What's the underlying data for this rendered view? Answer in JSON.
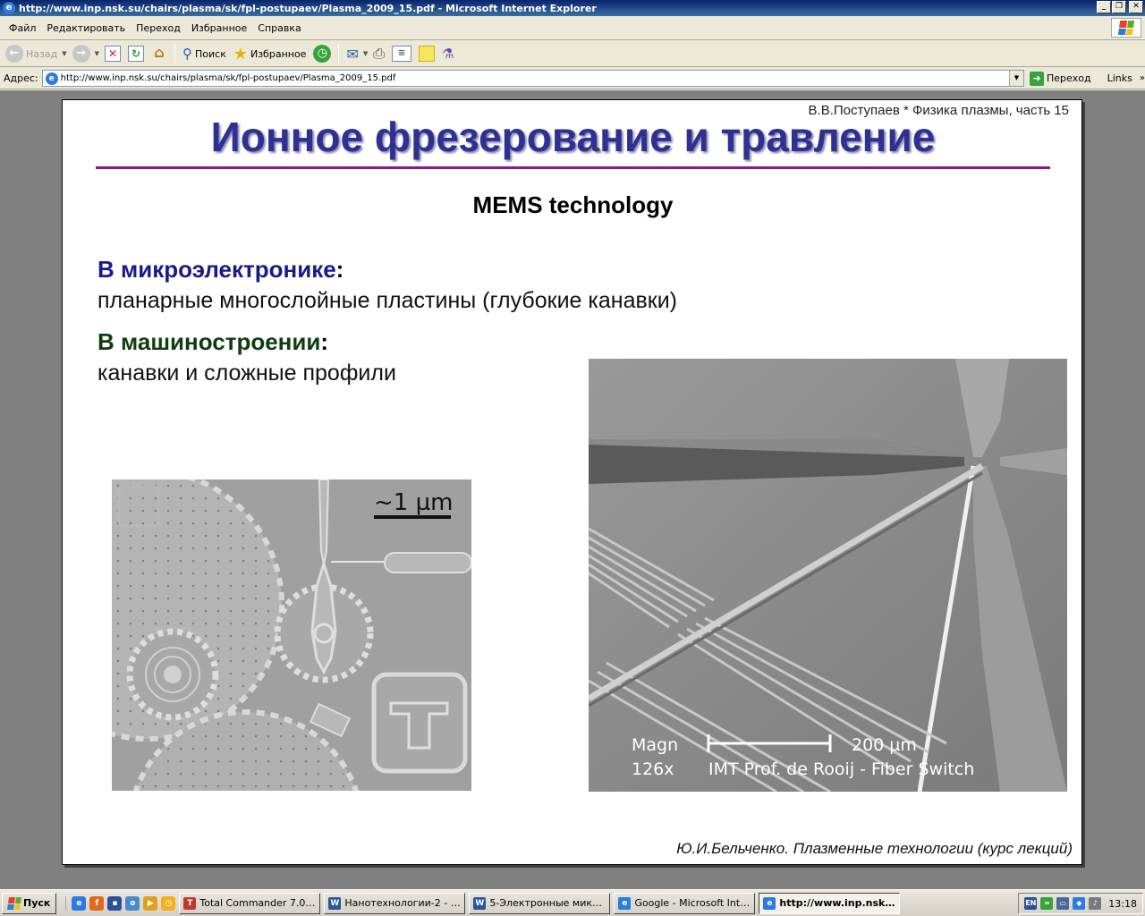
{
  "window": {
    "title": "http://www.inp.nsk.su/chairs/plasma/sk/fpl-postupaev/Plasma_2009_15.pdf - Microsoft Internet Explorer",
    "min_glyph": "_",
    "max_glyph": "❐",
    "close_glyph": "✕"
  },
  "menu": {
    "items": [
      "Файл",
      "Редактировать",
      "Переход",
      "Избранное",
      "Справка"
    ]
  },
  "toolbar": {
    "back_label": "Назад",
    "search_label": "Поиск",
    "favorites_label": "Избранное"
  },
  "address": {
    "label": "Адрес:",
    "url": "http://www.inp.nsk.su/chairs/plasma/sk/fpl-postupaev/Plasma_2009_15.pdf",
    "go_label": "Переход",
    "links_label": "Links"
  },
  "slide": {
    "author_top": "В.В.Поступаев * Физика плазмы, часть 15",
    "title": "Ионное фрезерование и травление",
    "subtitle": "MEMS technology",
    "heading1": "В микроэлектронике",
    "text1": "планарные многослойные пластины (глубокие канавки)",
    "heading2": "В машиностроении",
    "text2": "канавки и сложные профили",
    "colon": ":",
    "author_bottom": "Ю.И.Бельченко. Плазменные технологии (курс лекций)",
    "gears_scale": "~1 µm",
    "sem_magn_label": "Magn",
    "sem_magn_value": "126x",
    "sem_scale": "200 µm",
    "sem_credit": "IMT Prof. de Rooij  -  Fiber Switch"
  },
  "taskbar": {
    "start_label": "Пуск",
    "tasks": [
      {
        "label": "Total Commander 7.04 - ...",
        "color": "#c0392b",
        "glyph": "T"
      },
      {
        "label": "Нанотехнологии-2 - Mic...",
        "color": "#2b579a",
        "glyph": "W"
      },
      {
        "label": "5-Электронные микрос...",
        "color": "#2b579a",
        "glyph": "W"
      },
      {
        "label": "Google - Microsoft Intern...",
        "color": "#2b7be0",
        "glyph": "e"
      },
      {
        "label": "http://www.inp.nsk.s...",
        "color": "#2b7be0",
        "glyph": "e"
      }
    ],
    "lang": "EN",
    "clock": "13:18"
  }
}
